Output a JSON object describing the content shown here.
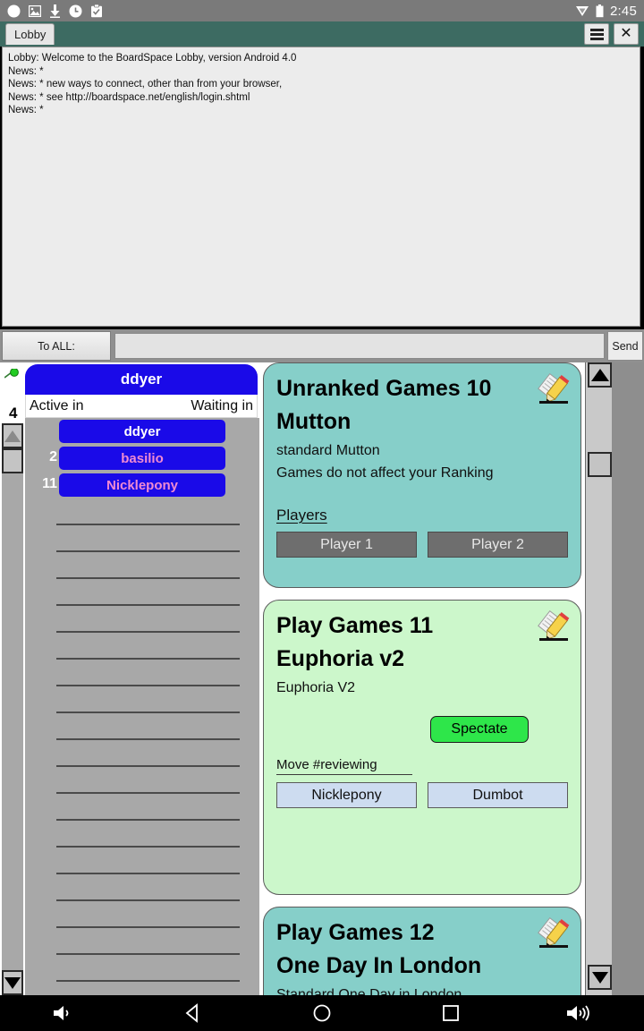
{
  "statusbar": {
    "clock": "2:45",
    "left_icons": [
      "circle-icon",
      "image-icon",
      "download-icon",
      "clock-icon",
      "clipboard-icon"
    ],
    "right_icons": [
      "wifi-icon",
      "battery-icon"
    ]
  },
  "titlebar": {
    "tab_label": "Lobby",
    "menu_icon": "hamburger-menu-icon",
    "close_icon": "close-icon"
  },
  "chatlog": {
    "lines": [
      "Lobby: Welcome to the BoardSpace Lobby, version Android 4.0",
      "News: *",
      "News: * new ways to connect, other than from your browser,",
      "News: * see http://boardspace.net/english/login.shtml",
      "News: *"
    ]
  },
  "chatbar": {
    "to_label": "To ALL:",
    "input_value": "",
    "input_placeholder": "",
    "send_label": "Send"
  },
  "users": {
    "header_name": "ddyer",
    "col_active": "Active in",
    "col_waiting": "Waiting in",
    "self_rank": "4",
    "rows": [
      {
        "count": "",
        "name": "ddyer",
        "name_color": "#ffffff"
      },
      {
        "count": "2",
        "name": "basilio",
        "name_color": "#f08ad2"
      },
      {
        "count": "11",
        "name": "Nicklepony",
        "name_color": "#f08ad2"
      }
    ],
    "empty_row_count": 18,
    "status_dot": "online-dot-icon"
  },
  "scrollbars": {
    "left_up": "triangle-up-icon",
    "left_down": "triangle-down-icon",
    "right_up": "triangle-up-icon",
    "right_down": "triangle-down-icon"
  },
  "games": [
    {
      "id": "card-unranked-mutton",
      "theme": "teal",
      "title_line1": "Unranked Games 10",
      "title_line2": "Mutton",
      "subtitle": "standard Mutton",
      "note": "Games do not affect your Ranking",
      "players_label": "Players",
      "seat_style": "dark",
      "seats": [
        "Player 1",
        "Player 2"
      ],
      "icon": "pencil-notepad-icon"
    },
    {
      "id": "card-play-euphoria",
      "theme": "green",
      "title_line1": "Play Games 11",
      "title_line2": "Euphoria v2",
      "subtitle": "Euphoria V2",
      "spectate_label": "Spectate",
      "move_label": "Move #reviewing",
      "seat_style": "light",
      "seats": [
        "Nicklepony",
        "Dumbot"
      ],
      "icon": "pencil-notepad-icon"
    },
    {
      "id": "card-play-london",
      "theme": "teal",
      "title_line1": "Play Games 12",
      "title_line2": "One Day In London",
      "subtitle": "Standard One Day in London",
      "icon": "pencil-notepad-icon"
    }
  ],
  "navbar": {
    "items": [
      "volume-down-icon",
      "back-icon",
      "home-icon",
      "recents-icon",
      "volume-up-icon"
    ]
  },
  "colors": {
    "titlebar": "#3d6b62",
    "user_button": "#1a0ae8",
    "card_teal": "#86cfc9",
    "card_green": "#ccf7cb",
    "spectate_green": "#2ee64a"
  }
}
